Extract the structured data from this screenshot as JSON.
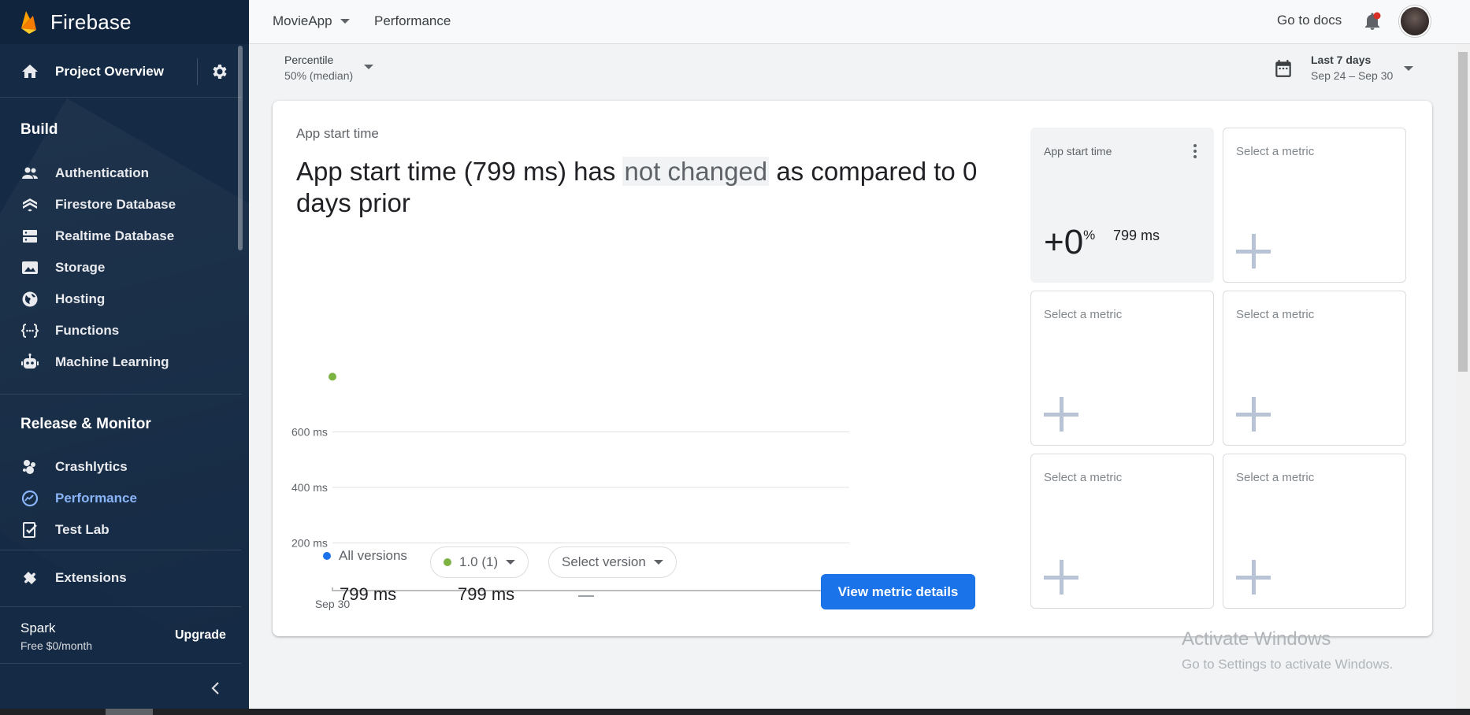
{
  "brand": {
    "name": "Firebase"
  },
  "sidebar": {
    "overview": "Project Overview",
    "build_title": "Build",
    "build_items": [
      {
        "label": "Authentication",
        "icon": "people-icon"
      },
      {
        "label": "Firestore Database",
        "icon": "firestore-icon"
      },
      {
        "label": "Realtime Database",
        "icon": "database-icon"
      },
      {
        "label": "Storage",
        "icon": "image-icon"
      },
      {
        "label": "Hosting",
        "icon": "globe-icon"
      },
      {
        "label": "Functions",
        "icon": "functions-icon"
      },
      {
        "label": "Machine Learning",
        "icon": "robot-icon"
      }
    ],
    "release_title": "Release & Monitor",
    "release_items": [
      {
        "label": "Crashlytics",
        "icon": "crashlytics-icon"
      },
      {
        "label": "Performance",
        "icon": "performance-icon",
        "active": true
      },
      {
        "label": "Test Lab",
        "icon": "checklist-icon"
      }
    ],
    "extensions": "Extensions",
    "plan_name": "Spark",
    "plan_price": "Free $0/month",
    "upgrade": "Upgrade"
  },
  "topbar": {
    "app": "MovieApp",
    "page": "Performance",
    "docs": "Go to docs"
  },
  "controls": {
    "percentile_label": "Percentile",
    "percentile_value": "50% (median)",
    "range_label": "Last 7 days",
    "range_value": "Sep 24 – Sep 30"
  },
  "card": {
    "label": "App start time",
    "headline_pre": "App start time (799 ms) has ",
    "headline_hl": "not changed",
    "headline_post": " as compared to 0 days prior",
    "legend_all": "All versions",
    "chip_version": "1.0 (1)",
    "chip_select": "Select version",
    "val_all": "799 ms",
    "val_version": "799 ms",
    "view_button": "View metric details"
  },
  "chart_data": {
    "type": "scatter",
    "x": [
      "Sep 30"
    ],
    "series": [
      {
        "values": [
          799
        ]
      }
    ],
    "yticks": [
      "600 ms",
      "400 ms",
      "200 ms"
    ],
    "ylim": [
      0,
      800
    ],
    "grid": true
  },
  "tiles": {
    "filled_label": "App start time",
    "filled_change": "+0",
    "filled_pct": "%",
    "filled_value": "799 ms",
    "empty_label": "Select a metric"
  },
  "colors": {
    "accent": "#1a73e8",
    "series_all": "#1a73e8",
    "series_version": "#7cb342",
    "sidebar": "#152a44"
  },
  "watermark": {
    "line1": "Activate Windows",
    "line2": "Go to Settings to activate Windows."
  }
}
